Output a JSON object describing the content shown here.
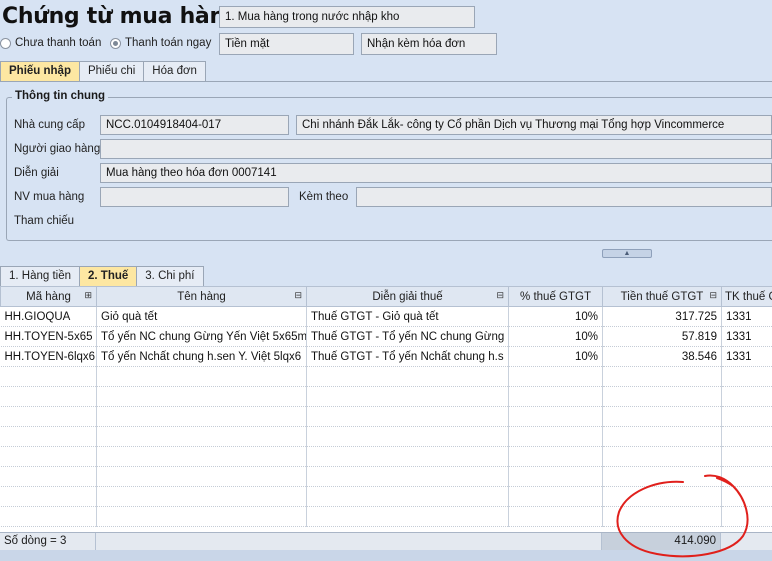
{
  "header": {
    "title": "Chứng từ mua hàng",
    "transaction_type": "1. Mua hàng trong nước nhập kho",
    "payment_options": [
      "Chưa thanh toán",
      "Thanh toán ngay"
    ],
    "payment_method": "Tiền mặt",
    "invoice_option": "Nhận kèm hóa đơn"
  },
  "top_tabs": [
    {
      "label": "Phiếu nhập",
      "active": true
    },
    {
      "label": "Phiếu chi",
      "active": false
    },
    {
      "label": "Hóa đơn",
      "active": false
    }
  ],
  "general": {
    "group_title": "Thông tin chung",
    "supplier_label": "Nhà cung cấp",
    "supplier_code": "NCC.0104918404-017",
    "supplier_name": "Chi nhánh Đắk Lắk- công ty Cổ phần Dịch vụ Thương mại Tổng hợp Vincommerce",
    "deliverer_label": "Người giao hàng",
    "deliverer_value": "",
    "description_label": "Diễn giải",
    "description_value": "Mua hàng theo hóa đơn 0007141",
    "buyer_label": "NV mua hàng",
    "buyer_value": "",
    "attach_label": "Kèm theo",
    "attach_value": "",
    "reference_label": "Tham chiếu"
  },
  "detail_tabs": [
    {
      "label": "1. Hàng tiền",
      "active": false
    },
    {
      "label": "2. Thuế",
      "active": true
    },
    {
      "label": "3. Chi phí",
      "active": false
    }
  ],
  "grid": {
    "columns": [
      "Mã hàng",
      "Tên hàng",
      "Diễn giải thuế",
      "% thuế GTGT",
      "Tiền thuế GTGT",
      "TK thuế G"
    ],
    "rows": [
      [
        "HH.GIOQUA",
        "Giỏ quà tết",
        "Thuế GTGT - Giỏ quà tết",
        "10%",
        "317.725",
        "1331"
      ],
      [
        "HH.TOYEN-5x65",
        "Tổ yến NC chung Gừng Yến Việt 5x65m",
        "Thuế GTGT - Tổ yến NC chung Gừng",
        "10%",
        "57.819",
        "1331"
      ],
      [
        "HH.TOYEN-6lqx6",
        "Tổ yến Nchất chung h.sen Y. Việt 5lqx6",
        "Thuế GTGT - Tổ yến Nchất chung h.s",
        "10%",
        "38.546",
        "1331"
      ]
    ],
    "row_count_label": "Số dòng = 3",
    "total_tax": "414.090"
  },
  "colors": {
    "background": "#d7e3f3",
    "active_tab": "#fde7a2",
    "annotation": "#e0201c"
  }
}
